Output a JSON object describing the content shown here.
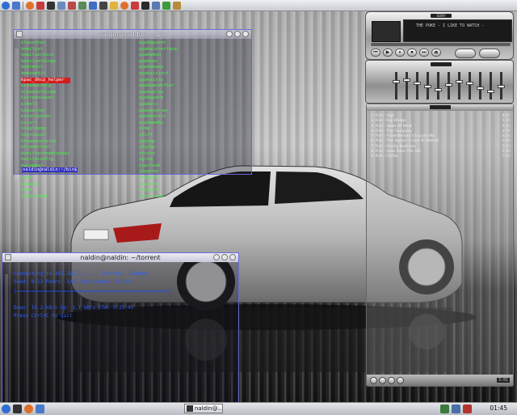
{
  "top_panel": {
    "launchers": [
      "kde-menu-icon",
      "home-icon",
      "firefox-icon",
      "konqueror-icon",
      "terminal-icon",
      "settings-icon",
      "mail-icon",
      "calendar-icon",
      "help-icon",
      "terminal-icon",
      "kopete-icon",
      "firefox-icon",
      "konqueror-icon",
      "terminal-icon",
      "editor-icon",
      "music-icon",
      "image-icon"
    ],
    "clock": ""
  },
  "terminal1": {
    "title": "naldin@naldin: ~/bin",
    "col1": [
      "klauncher",
      "kmailcvt",
      "kmailservice",
      "kmailsettings",
      "kmdredit",
      "kmenuedit",
      "kpac_dhcp_helper",
      "kreadconfig",
      "kreadsettings",
      "kscreensaver",
      "kshell",
      "ksmserver",
      "kstartperms",
      "kstart",
      "ksvgtopng",
      "ksyncuser",
      "kthemeservice",
      "ktradertest",
      "kunittestmodrunner",
      "kwriteconfig",
      "kwrapper",
      "kwriteconfig",
      "kxkb",
      "l2ping",
      "lame",
      "lameglobal"
    ],
    "highlight": "kpac_dhcp_helper",
    "col2": [
      "quakepaint",
      "quakeinterface",
      "quakemon",
      "quakepc",
      "quakebase",
      "quakeinject",
      "quakeinfo",
      "quakemodifier",
      "quakeplay",
      "quakeperm",
      "quakelz",
      "quakeserver",
      "quakeutils",
      "quakewebs",
      "zcmp",
      "zdiff",
      "zegrep",
      "zfgrep",
      "zforce",
      "zgrep",
      "zipcloak",
      "zipgrep",
      "zipinfo",
      "zipnote",
      "zipsplit",
      "zipstream"
    ],
    "prompt": "naldin@naldin:~/bin$"
  },
  "terminal2": {
    "title": "naldin@naldin: ~/torrent",
    "line1": "  Connecting to 192.168.1.1 ...  Torrent: Jukebox",
    "line2": "  Seed: 0/12   Peers: 3/45   Downloaded: 52.1%",
    "line3": "  [====================================================]",
    "line4": "  Down: 15.2 kB/s   Up: 3.1 kB/s   ETA: 1:23:45",
    "line5": "  Press Ctrl+C to quit"
  },
  "player": {
    "brand": "SONY",
    "track_display": "THE PUKE - I LIKE TO WATCH -",
    "time": "3:01",
    "playlist_title": "SONY",
    "playlist": [
      {
        "title": "1. Fish - Vigil",
        "time": "8:47"
      },
      {
        "title": "2. Fish - Big Wedge",
        "time": "5:25"
      },
      {
        "title": "3. Fish - State Of Mind",
        "time": "4:45"
      },
      {
        "title": "4. Fish - The Company",
        "time": "4:59"
      },
      {
        "title": "5. Fish - A Gentleman's Excuse Me",
        "time": "4:16"
      },
      {
        "title": "6. Fish - The Voyeur (I Like To Watch)",
        "time": "4:46"
      },
      {
        "title": "7. Fish - Family Business",
        "time": "5:23"
      },
      {
        "title": "8. Fish - View From The Hill",
        "time": "6:40"
      },
      {
        "title": "9. Fish - Cliche",
        "time": "7:01"
      }
    ]
  },
  "taskbar": {
    "task_label": "naldin@...",
    "clock": "01:45"
  }
}
